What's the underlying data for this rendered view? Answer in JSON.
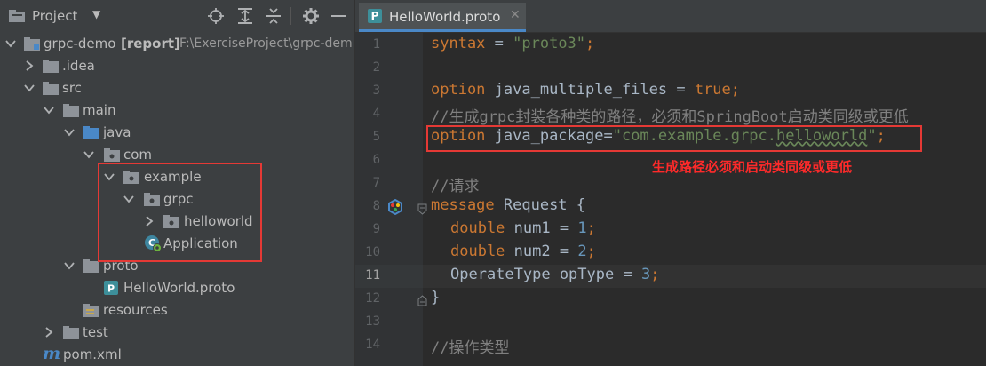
{
  "project_panel": {
    "title": "Project",
    "tree": [
      {
        "id": "root",
        "label": "grpc-demo",
        "badge": "[report]",
        "path": "F:\\ExerciseProject\\grpc-dem"
      },
      {
        "id": "idea",
        "label": ".idea"
      },
      {
        "id": "src",
        "label": "src"
      },
      {
        "id": "main",
        "label": "main"
      },
      {
        "id": "java",
        "label": "java"
      },
      {
        "id": "com",
        "label": "com"
      },
      {
        "id": "example",
        "label": "example"
      },
      {
        "id": "grpc",
        "label": "grpc"
      },
      {
        "id": "helloworld",
        "label": "helloworld"
      },
      {
        "id": "application",
        "label": "Application"
      },
      {
        "id": "proto",
        "label": "proto"
      },
      {
        "id": "helloworld_proto",
        "label": "HelloWorld.proto"
      },
      {
        "id": "resources",
        "label": "resources"
      },
      {
        "id": "test",
        "label": "test"
      },
      {
        "id": "pom",
        "label": "pom.xml"
      }
    ]
  },
  "editor": {
    "tab_label": "HelloWorld.proto",
    "tab_icon_letter": "P",
    "line_numbers": [
      "1",
      "2",
      "3",
      "4",
      "5",
      "6",
      "7",
      "8",
      "9",
      "10",
      "11",
      "12",
      "13",
      "14"
    ],
    "current_line": "11",
    "code": {
      "l1_kw": "syntax",
      "l1_eq": " = ",
      "l1_str": "\"proto3\"",
      "l1_end": ";",
      "l3_kw": "option",
      "l3_mid": " java_multiple_files = ",
      "l3_val": "true",
      "l3_end": ";",
      "l4_comment": "//生成grpc封装各种类的路径，必须和SpringBoot启动类同级或更低",
      "l5_kw": "option",
      "l5_mid": " java_package=",
      "l5_str_a": "\"com.example.grpc.",
      "l5_str_b": "helloworld",
      "l5_str_c": "\"",
      "l5_end": ";",
      "l7_comment": "//请求",
      "l8_kw": "message",
      "l8_rest": " Request {",
      "l9_kw": "double",
      "l9_mid": " num1 = ",
      "l9_num": "1",
      "l9_end": ";",
      "l10_kw": "double",
      "l10_mid": " num2 = ",
      "l10_num": "2",
      "l10_end": ";",
      "l11_mid": "OperateType opType = ",
      "l11_num": "3",
      "l11_end": ";",
      "l12": "}",
      "l14_comment": "//操作类型"
    },
    "annotation": "生成路径必须和启动类同级或更低"
  },
  "colors": {
    "keyword": "#cc7832",
    "string": "#6a8759",
    "number": "#6897bb",
    "comment": "#808080",
    "annotation_red": "#e53935"
  }
}
